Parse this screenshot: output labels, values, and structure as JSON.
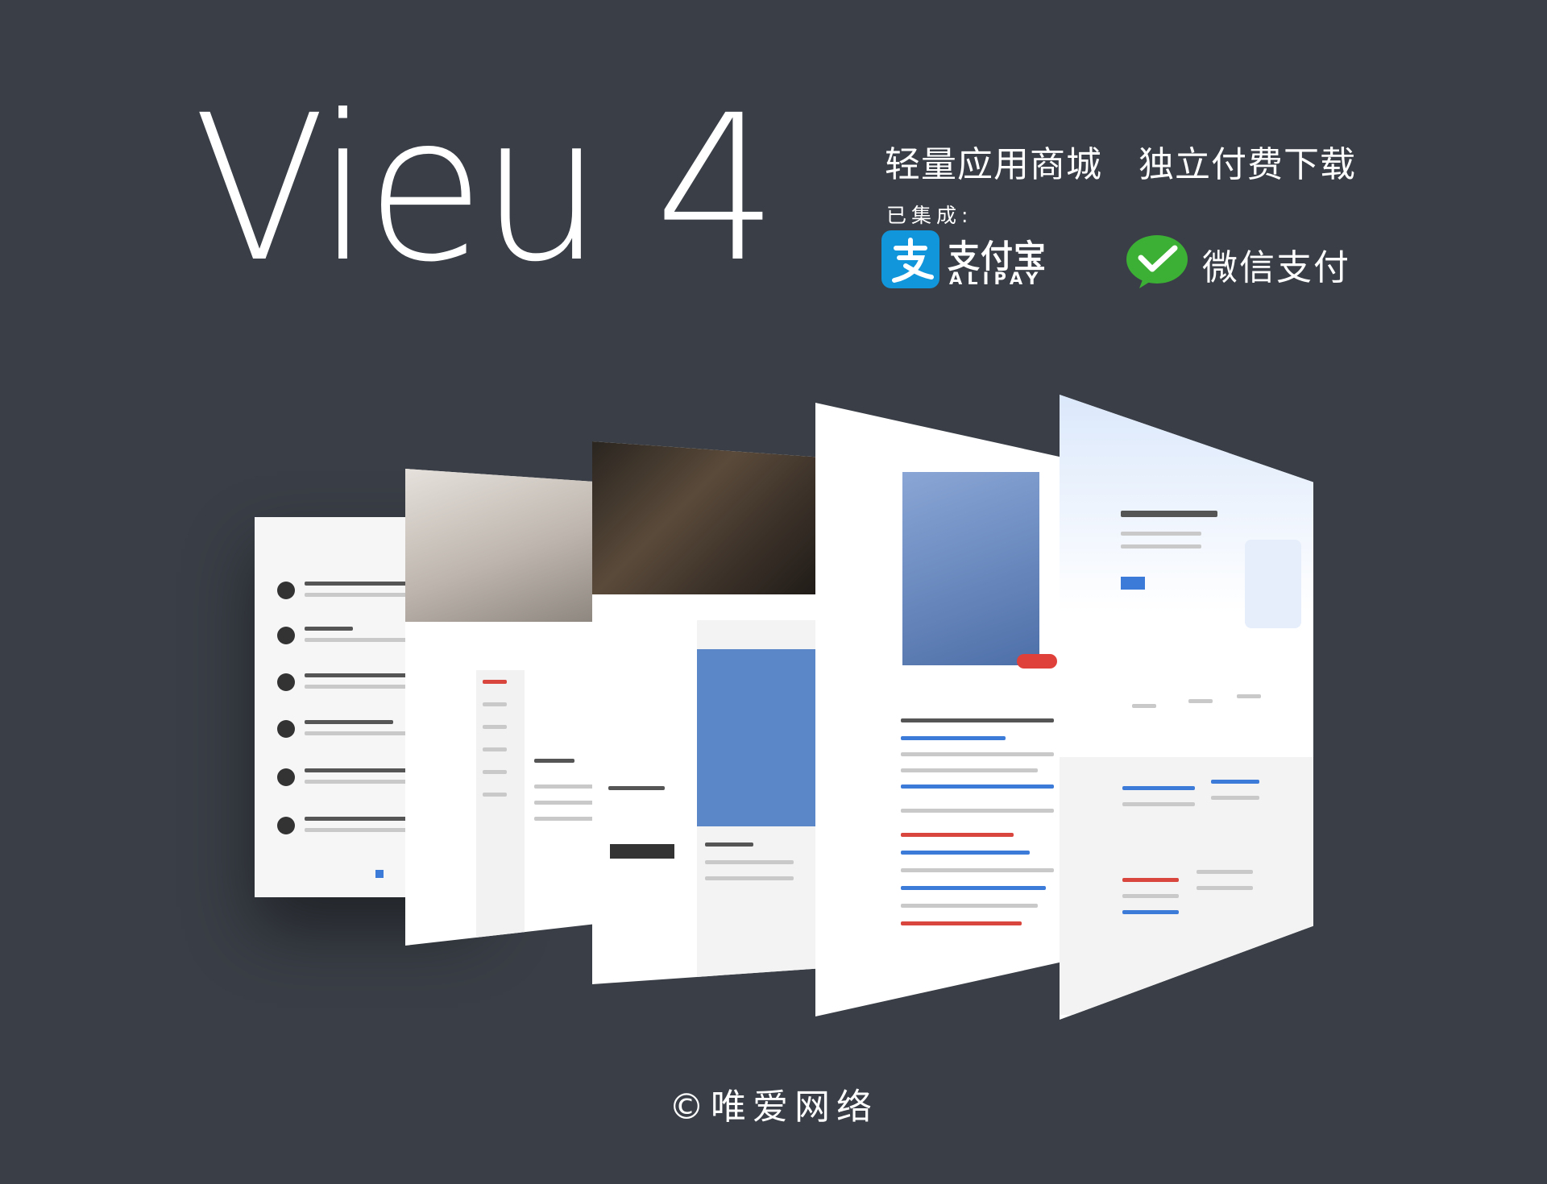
{
  "hero": {
    "title": "Vieu 4"
  },
  "tagline": {
    "text": "轻量应用商城   独立付费下载"
  },
  "integrations": {
    "label": "已集成:",
    "alipay": {
      "name_cn": "支付宝",
      "name_en": "ALIPAY",
      "icon": "alipay-icon",
      "color": "#1296db"
    },
    "wechat": {
      "name": "微信支付",
      "icon": "wechat-pay-icon",
      "color": "#3cb034"
    }
  },
  "footer": {
    "copyright": "©唯爱网络"
  },
  "colors": {
    "background": "#3a3f47",
    "text": "#ffffff"
  }
}
